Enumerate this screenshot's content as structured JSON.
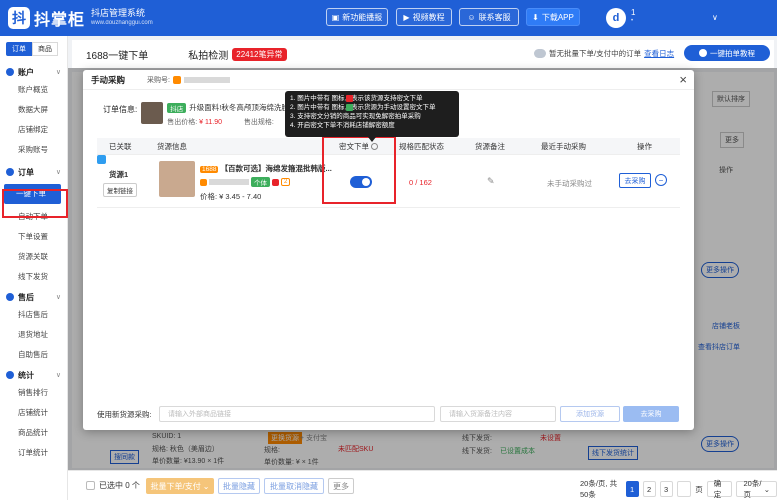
{
  "header": {
    "logo_mark": "抖",
    "logo_name": "抖掌柜",
    "logo_sub_title": "抖店管理系统",
    "logo_sub_url": "www.douzhanggui.com",
    "buttons": [
      {
        "label": "新功能播报"
      },
      {
        "label": "视频教程"
      },
      {
        "label": "联系客服"
      },
      {
        "label": "下载APP"
      }
    ],
    "avatar_letter": "d",
    "user_line1": "1",
    "user_line2": "•",
    "chevron": "∨"
  },
  "sidebar": {
    "tabs": [
      "订单",
      "商品"
    ],
    "groups": [
      {
        "name": "账户",
        "items": [
          "账户概览",
          "数据大屏",
          "店铺绑定",
          "采购账号"
        ]
      },
      {
        "name": "订单",
        "items": [
          "一键下单",
          "自动下单",
          "下单设置",
          "货源关联",
          "线下发货"
        ]
      },
      {
        "name": "售后",
        "items": [
          "抖店售后",
          "退货地址",
          "自助售后"
        ]
      },
      {
        "name": "统计",
        "items": [
          "销售排行",
          "店铺统计",
          "商品统计",
          "订单统计"
        ]
      }
    ],
    "chevron": "∨"
  },
  "topbar": {
    "title": "1688一键下单",
    "tab": "私拍检测",
    "badge": "22412笔异常",
    "notice": "暂无批量下单/支付中的订单",
    "notice_link": "查看日志",
    "guide_button": "一键拍单教程"
  },
  "background": {
    "sort": "默认排序",
    "more": "更多",
    "op_header": "操作",
    "more_ops": "更多操作",
    "view_douyin_order": "查看抖店订单",
    "cs_note": "店铺老板",
    "skuid": "SKUID: 1",
    "spec": "规格: 秋色（美眉边）",
    "qty": "单价数量: ¥13.90 × 1件",
    "change_source": "更换货源",
    "unconfigured_sku": "未匹配SKU",
    "spec_label": "规格:",
    "spec_val": "+ 支付宝",
    "qty2": "单价数量: ¥ × 1件",
    "offline_ship": "线下发货:",
    "set_cost": "已设置成本",
    "offline_ship2": "线下发货:",
    "unset_tag": "未设置",
    "ship_stat": "线下发货统计",
    "search_again": "搜同款"
  },
  "modal": {
    "title": "手动采购",
    "account_label": "采购号:",
    "close": "×",
    "order_label": "订单信息:",
    "order_tag": "抖店",
    "order_title": "升级面料!秋冬高颅顶海绵洗脸",
    "order_price_label": "售出价格:",
    "order_price": "¥ 11.90",
    "order_spec_label": "售出规格:",
    "columns": [
      "已关联",
      "货源信息",
      "密文下单",
      "规格匹配状态",
      "货源备注",
      "最近手动采购",
      "操作"
    ],
    "row": {
      "source_label": "货源1",
      "copy_link": "复制链接",
      "tag_1688": "1688",
      "source_title": "【百款可选】海绵发箍混批韩版...",
      "seller_tag": "个体",
      "level_tag": "2",
      "price": "价格: ¥ 3.45 - 7.40",
      "match_status": "0 / 162",
      "last_purchase": "未手动采购过",
      "purchase_button": "去采购",
      "minus": "−"
    },
    "footer": {
      "label": "使用新货源采购:",
      "link_placeholder": "请输入外部商品链接",
      "remark_placeholder": "请输入货源备注内容",
      "add_source": "添加货源",
      "go_purchase": "去采购"
    }
  },
  "tooltip": {
    "lines": [
      "1. 图片中带有      图标，表示该货源支持密文下单",
      "2. 图片中带有      图标，表示货源为手动设置密文下单",
      "3. 支持密文分销的商品可实现免解密拍单采购",
      "4. 开启密文下单不消耗店铺解密额度"
    ]
  },
  "bottombar": {
    "selected": "已选中 0 个",
    "batch_pay": "批量下单/支付",
    "batch_hide": "批量隐藏",
    "batch_unhide": "批量取消隐藏",
    "more": "更多",
    "total": "20条/页, 共50条",
    "pages": [
      "1",
      "2",
      "3"
    ],
    "page_label": "页",
    "confirm": "确定",
    "page_size": "20条/页"
  },
  "colors": {
    "primary": "#1f5fd6",
    "danger": "#e8232a",
    "tag_green": "#3dae5c",
    "tag_orange": "#ff8a00"
  }
}
